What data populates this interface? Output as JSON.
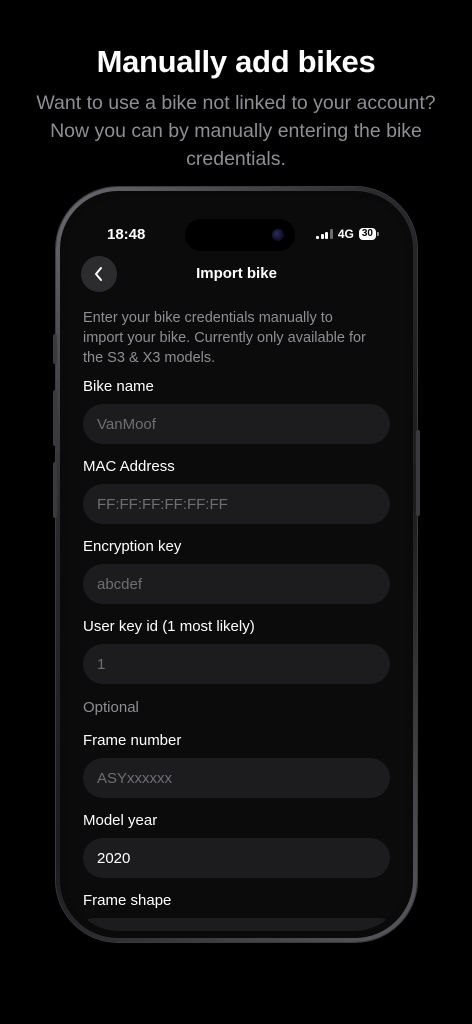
{
  "promo": {
    "headline": "Manually add bikes",
    "subline": "Want to use a bike not linked to your account? Now you can by manually entering the bike credentials."
  },
  "status_bar": {
    "time": "18:48",
    "network": "4G",
    "battery": "30",
    "icons": [
      "signal-icon",
      "battery-icon"
    ]
  },
  "nav": {
    "title": "Import bike",
    "back_icon": "chevron-left-icon"
  },
  "intro_text": "Enter your bike credentials manually to import your bike. Currently only available for the S3 & X3 models.",
  "fields": {
    "bike_name": {
      "label": "Bike name",
      "placeholder": "VanMoof",
      "value": ""
    },
    "mac_address": {
      "label": "MAC Address",
      "placeholder": "FF:FF:FF:FF:FF:FF",
      "value": ""
    },
    "encryption_key": {
      "label": "Encryption key",
      "placeholder": "abcdef",
      "value": ""
    },
    "user_key_id": {
      "label": "User key id (1 most likely)",
      "placeholder": "1",
      "value": ""
    },
    "frame_number": {
      "label": "Frame number",
      "placeholder": "ASYxxxxxx",
      "value": ""
    },
    "model_year": {
      "label": "Model year",
      "placeholder": "",
      "value": "2020"
    },
    "frame_shape": {
      "label": "Frame shape",
      "placeholder": "",
      "value": ""
    }
  },
  "sections": {
    "optional": "Optional"
  },
  "colors": {
    "background": "#000000",
    "screen": "#0b0b0b",
    "input_bg": "#1c1c1e",
    "muted_text": "#8e8e93",
    "placeholder": "#6e6e73",
    "text": "#ffffff"
  }
}
